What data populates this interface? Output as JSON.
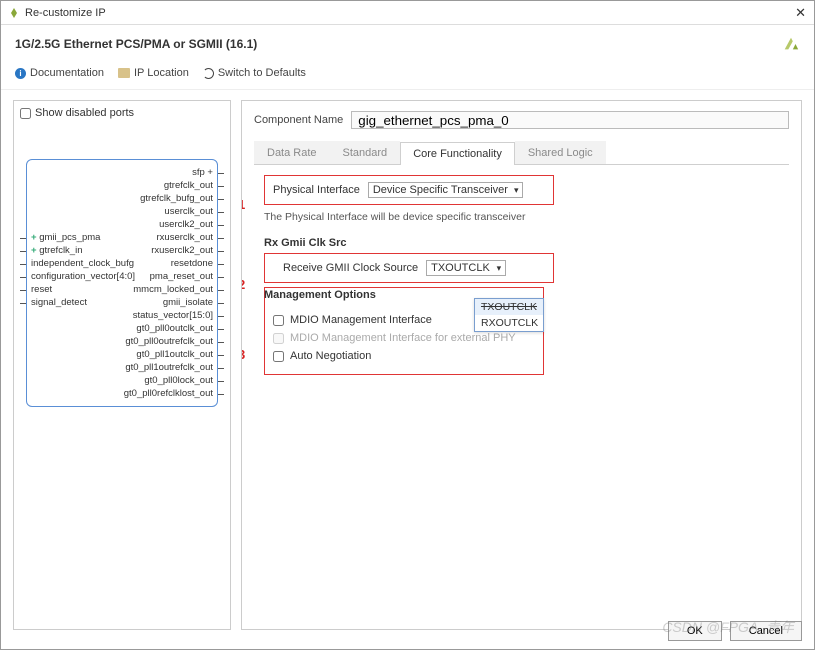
{
  "window": {
    "title": "Re-customize IP"
  },
  "header": {
    "ip_name": "1G/2.5G Ethernet PCS/PMA or SGMII (16.1)"
  },
  "toolbar": {
    "documentation": "Documentation",
    "ip_location": "IP Location",
    "switch_defaults": "Switch to Defaults"
  },
  "left": {
    "show_disabled": "Show disabled ports",
    "schematic": {
      "left_ports": [
        {
          "t": "",
          "plus": false
        },
        {
          "t": "",
          "plus": false
        },
        {
          "t": "",
          "plus": false
        },
        {
          "t": "",
          "plus": false
        },
        {
          "t": "",
          "plus": false
        },
        {
          "t": "gmii_pcs_pma",
          "plus": true
        },
        {
          "t": "gtrefclk_in",
          "plus": true
        },
        {
          "t": "independent_clock_bufg",
          "plus": false
        },
        {
          "t": "configuration_vector[4:0]",
          "plus": false
        },
        {
          "t": "reset",
          "plus": false
        },
        {
          "t": "signal_detect",
          "plus": false
        }
      ],
      "right_ports": [
        "sfp +",
        "gtrefclk_out",
        "gtrefclk_bufg_out",
        "userclk_out",
        "userclk2_out",
        "rxuserclk_out",
        "rxuserclk2_out",
        "resetdone",
        "pma_reset_out",
        "mmcm_locked_out",
        "gmii_isolate",
        "status_vector[15:0]",
        "gt0_pll0outclk_out",
        "gt0_pll0outrefclk_out",
        "gt0_pll1outclk_out",
        "gt0_pll1outrefclk_out",
        "gt0_pll0lock_out",
        "gt0_pll0refclklost_out"
      ]
    }
  },
  "right": {
    "component_name_label": "Component Name",
    "component_name_value": "gig_ethernet_pcs_pma_0",
    "tabs": [
      "Data Rate",
      "Standard",
      "Core Functionality",
      "Shared Logic"
    ],
    "active_tab": "Core Functionality",
    "annotations": {
      "a1": "1",
      "a2": "2",
      "a3": "3"
    },
    "phys_if": {
      "label": "Physical Interface",
      "value": "Device Specific Transceiver",
      "help": "The Physical Interface will be device specific transceiver"
    },
    "rx_group": {
      "title": "Rx Gmii Clk Src",
      "label": "Receive GMII Clock Source",
      "value": "TXOUTCLK",
      "options": [
        "TXOUTCLK",
        "RXOUTCLK"
      ]
    },
    "mgmt": {
      "title": "Management Options",
      "mdio": "MDIO Management Interface",
      "mdio_ext": "MDIO Management Interface for external PHY",
      "auto_neg": "Auto Negotiation"
    }
  },
  "footer": {
    "ok": "OK",
    "cancel": "Cancel"
  },
  "watermark": "CSDN @FPGA_青年"
}
